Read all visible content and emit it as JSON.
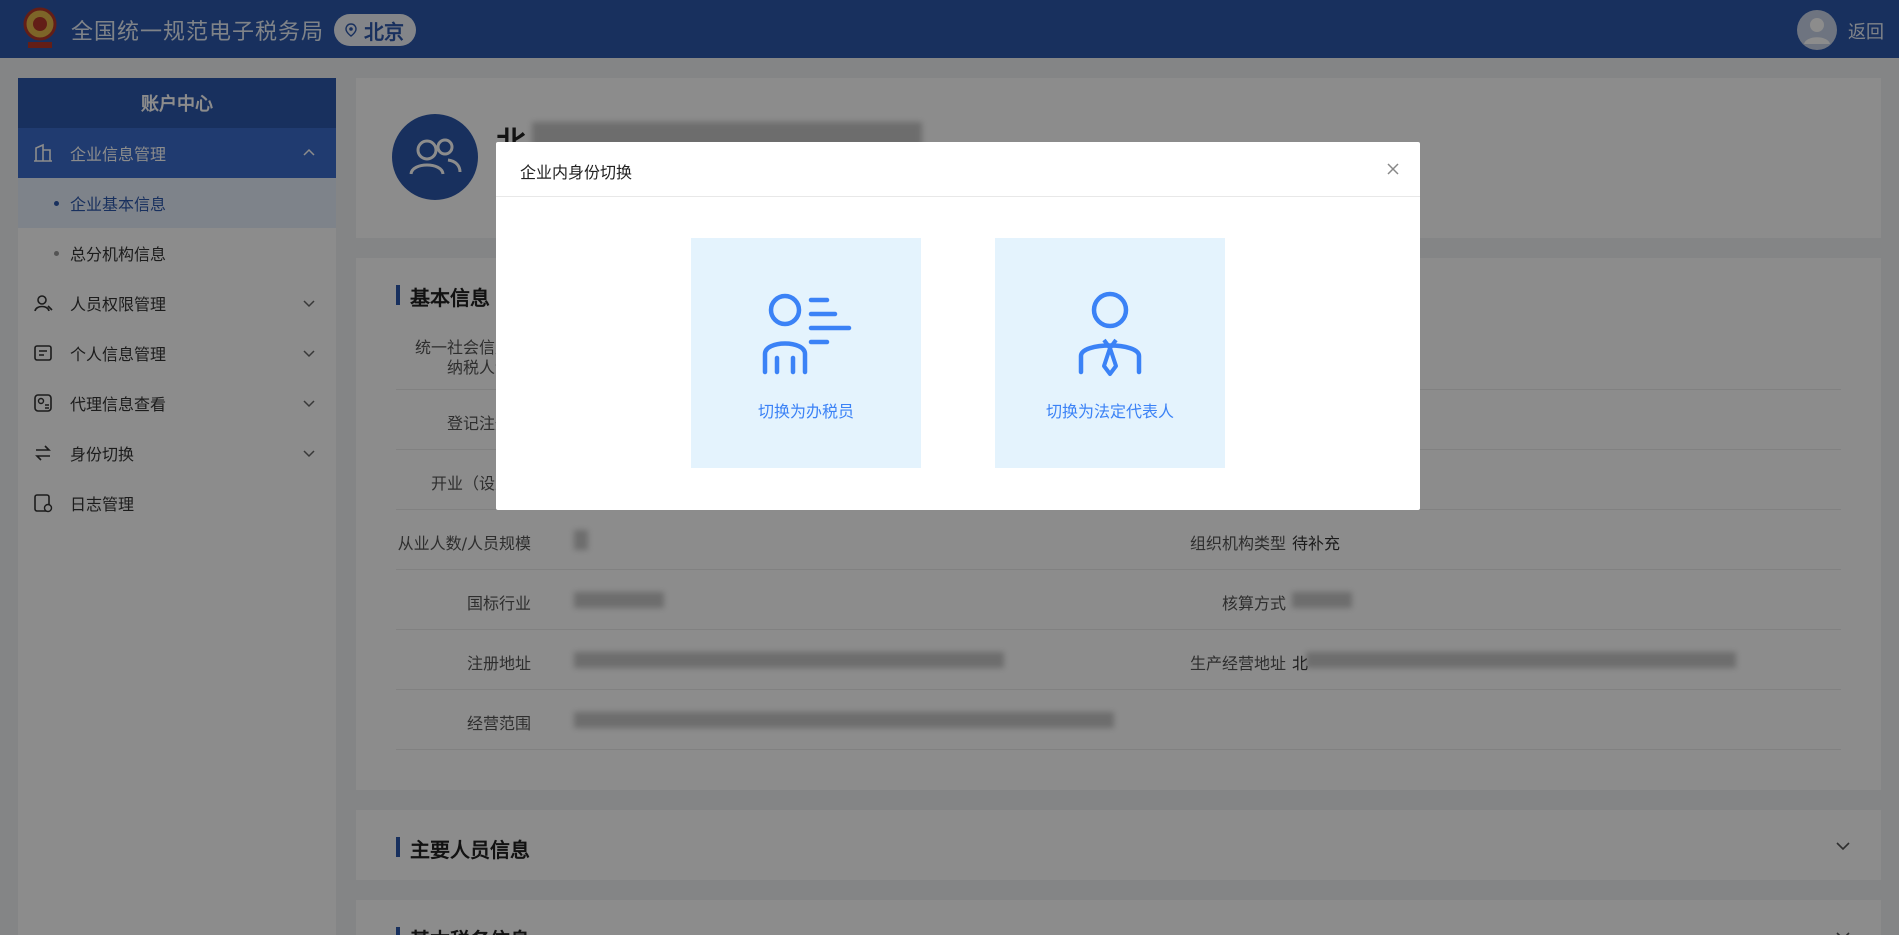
{
  "header": {
    "app_title": "全国统一规范电子税务局",
    "region": "北京",
    "back_label": "返回"
  },
  "sidebar": {
    "title": "账户中心",
    "groups": [
      {
        "label": "企业信息管理",
        "icon": "building-icon",
        "expanded": true,
        "items": [
          {
            "label": "企业基本信息",
            "active": true
          },
          {
            "label": "总分机构信息",
            "active": false
          }
        ]
      },
      {
        "label": "人员权限管理",
        "icon": "user-permission-icon",
        "expanded": false
      },
      {
        "label": "个人信息管理",
        "icon": "profile-card-icon",
        "expanded": false
      },
      {
        "label": "代理信息查看",
        "icon": "agent-icon",
        "expanded": false
      },
      {
        "label": "身份切换",
        "icon": "switch-icon",
        "expanded": false
      },
      {
        "label": "日志管理",
        "icon": "log-icon",
        "expanded": false
      }
    ]
  },
  "company": {
    "name_visible": "北"
  },
  "basic_info": {
    "title": "基本信息",
    "rows": [
      {
        "label": "统一社会信用代码/纳税人识别号",
        "label_lines": [
          "统一社会信用",
          "纳税人识"
        ]
      },
      {
        "label": "登记注册类型",
        "label_visible": "登记注册"
      },
      {
        "label": "开业（设立）日期",
        "label_visible": "开业（设立"
      },
      {
        "label": "从业人数/人员规模",
        "right_label": "组织机构类型",
        "right_value": "待补充"
      },
      {
        "label": "国标行业",
        "right_label": "核算方式"
      },
      {
        "label": "注册地址",
        "right_label": "生产经营地址",
        "value_visible": "北"
      },
      {
        "label": "经营范围"
      }
    ]
  },
  "sections": {
    "main_personnel": "主要人员信息",
    "basic_tax": "基本税务信息"
  },
  "modal": {
    "title": "企业内身份切换",
    "options": [
      {
        "label": "切换为办税员",
        "icon": "tax-clerk-icon"
      },
      {
        "label": "切换为法定代表人",
        "icon": "legal-representative-icon"
      }
    ]
  },
  "colors": {
    "primary": "#2d58ac",
    "accent": "#3b82f6",
    "card_bg": "#e4f3fd"
  }
}
